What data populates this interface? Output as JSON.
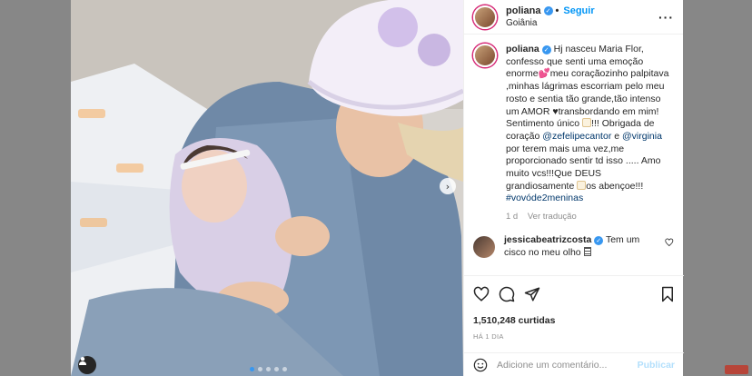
{
  "colors": {
    "accent": "#0095f6",
    "verified": "#3897f0",
    "text": "#262626",
    "muted": "#8e8e8e",
    "mention": "#00376b"
  },
  "post": {
    "username": "poliana",
    "follow_label": "Seguir",
    "separator": "•",
    "location": "Goiânia",
    "more_icon": "more-icon"
  },
  "caption": {
    "username": "poliana",
    "text_1": "Hj nasceu Maria Flor, confesso que senti uma emoção enorme",
    "text_2": "meu coraçãozinho palpitava ,minhas lágrimas escorriam pelo meu rosto e sentia tão grande,tão intenso um AMOR ",
    "text_3": "transbordando em mim! Sentimento único ",
    "text_4": "!!! Obrigada de coração ",
    "mention_1": "@zefelipecantor",
    "text_5": " e ",
    "mention_2": "@virginia",
    "text_6": " por terem mais uma vez,me proporcionado sentir td isso ..... Amo muito vcs!!!Que DEUS grandiosamente ",
    "text_7": "os abençoe!!! ",
    "hashtag": "#vovóde2meninas",
    "age": "1 d",
    "see_translation": "Ver tradução"
  },
  "comment": {
    "username": "jessicabeatrizcosta",
    "text": "Tem um cisco no meu olho"
  },
  "stats": {
    "likes": "1,510,248 curtidas",
    "posted_ago": "HÁ 1 DIA"
  },
  "composer": {
    "placeholder": "Adicione um comentário...",
    "publish_label": "Publicar"
  },
  "carousel": {
    "slide_count": 5,
    "active_index": 0
  }
}
